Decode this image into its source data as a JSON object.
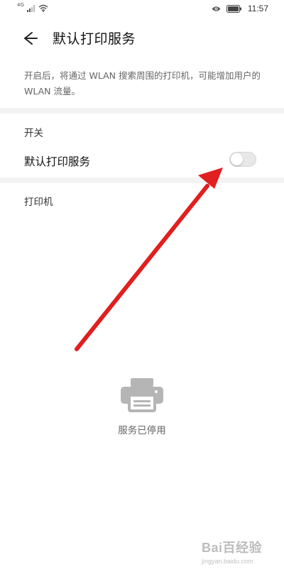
{
  "status_bar": {
    "network_label": "4G",
    "time": "11:57",
    "icons": [
      "signal-icon",
      "wifi-icon",
      "eye-icon",
      "battery-icon"
    ]
  },
  "header": {
    "title": "默认打印服务",
    "back_icon": "arrow-left-icon"
  },
  "description": "开启后，将通过 WLAN 搜索周围的打印机，可能增加用户的 WLAN 流量。",
  "switch_section": {
    "label": "开关",
    "row_label": "默认打印服务",
    "toggle_on": false
  },
  "printers_section": {
    "label": "打印机"
  },
  "empty_state": {
    "icon": "printer-icon",
    "text": "服务已停用"
  },
  "annotation": {
    "color": "#e02020",
    "icon": "red-arrow"
  },
  "watermark": {
    "logo_text": "Bai百经验",
    "url": "jingyan.baidu.com"
  },
  "colors": {
    "background": "#ffffff",
    "divider": "#f3f3f3",
    "toggle_off": "#e8e8e8"
  }
}
